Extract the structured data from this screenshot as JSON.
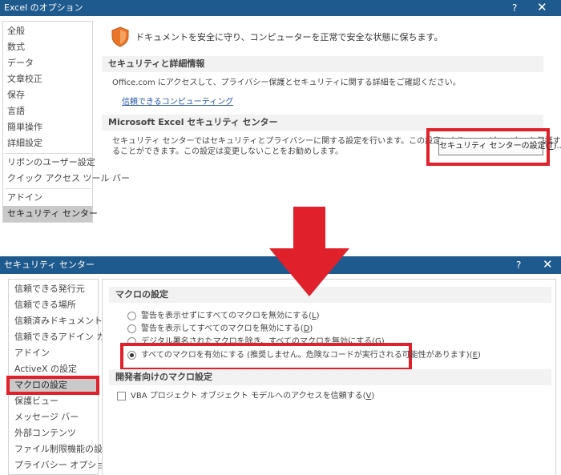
{
  "top_dialog": {
    "title": "Excel のオプション",
    "help": "?",
    "close": "✕",
    "nav": [
      {
        "label": "全般"
      },
      {
        "label": "数式"
      },
      {
        "label": "データ"
      },
      {
        "label": "文章校正"
      },
      {
        "label": "保存"
      },
      {
        "label": "言語"
      },
      {
        "label": "簡単操作"
      },
      {
        "label": "詳細設定"
      },
      {
        "label": "リボンのユーザー設定"
      },
      {
        "label": "クイック アクセス ツール バー"
      },
      {
        "label": "アドイン"
      },
      {
        "label": "セキュリティ センター",
        "selected": true
      }
    ],
    "intro": "ドキュメントを安全に守り、コンピューターを正常で安全な状態に保ちます。",
    "section1_header": "セキュリティと詳細情報",
    "section1_text": "Office.com にアクセスして、プライバシー保護とセキュリティに関する詳細をご確認ください。",
    "section1_link": "信頼できるコンピューティング",
    "section2_header": "Microsoft Excel セキュリティ センター",
    "section2_text_line1": "セキュリティ センターではセキュリティとプライバシーに関する設定を行います。この設定により、コンピューターを保護す",
    "section2_text_line2": "ることができます。この設定は変更しないことをお勧めします。",
    "trust_center_button": "セキュリティ センターの設定(T)...",
    "trust_center_button_prefix": "セキュリティ センターの設定(",
    "trust_center_button_key": "T",
    "trust_center_button_suffix": ")..."
  },
  "bottom_dialog": {
    "title": "セキュリティ センター",
    "help": "?",
    "close": "✕",
    "nav": [
      {
        "label": "信頼できる発行元"
      },
      {
        "label": "信頼できる場所"
      },
      {
        "label": "信頼済みドキュメント"
      },
      {
        "label": "信頼できるアドイン カタログ"
      },
      {
        "label": "アドイン"
      },
      {
        "label": "ActiveX の設定"
      },
      {
        "label": "マクロの設定",
        "selected": true
      },
      {
        "label": "保護ビュー"
      },
      {
        "label": "メッセージ バー"
      },
      {
        "label": "外部コンテンツ"
      },
      {
        "label": "ファイル制限機能の設定"
      },
      {
        "label": "プライバシー オプション"
      }
    ],
    "macro_header": "マクロの設定",
    "options": [
      {
        "prefix": "警告を表示せずにすべてのマクロを無効にする(",
        "key": "L",
        "suffix": ")",
        "selected": false
      },
      {
        "prefix": "警告を表示してすべてのマクロを無効にする(",
        "key": "D",
        "suffix": ")",
        "selected": false
      },
      {
        "prefix": "デジタル署名されたマクロを除き、すべてのマクロを無効にする(",
        "key": "G",
        "suffix": ")",
        "selected": false
      },
      {
        "prefix": "すべてのマクロを有効にする (推奨しません。危険なコードが実行される可能性があります)(",
        "key": "E",
        "suffix": ")",
        "selected": true
      }
    ],
    "dev_header": "開発者向けのマクロ設定",
    "vba_checkbox": {
      "prefix": "VBA プロジェクト オブジェクト モデルへのアクセスを信頼する(",
      "key": "V",
      "suffix": ")",
      "checked": false
    }
  },
  "colors": {
    "titlebar": "#1e5a8e",
    "highlight": "#e0202a",
    "nav_selected": "#c9c9c9",
    "link": "#2b58a8",
    "shield": "#e8752a"
  }
}
